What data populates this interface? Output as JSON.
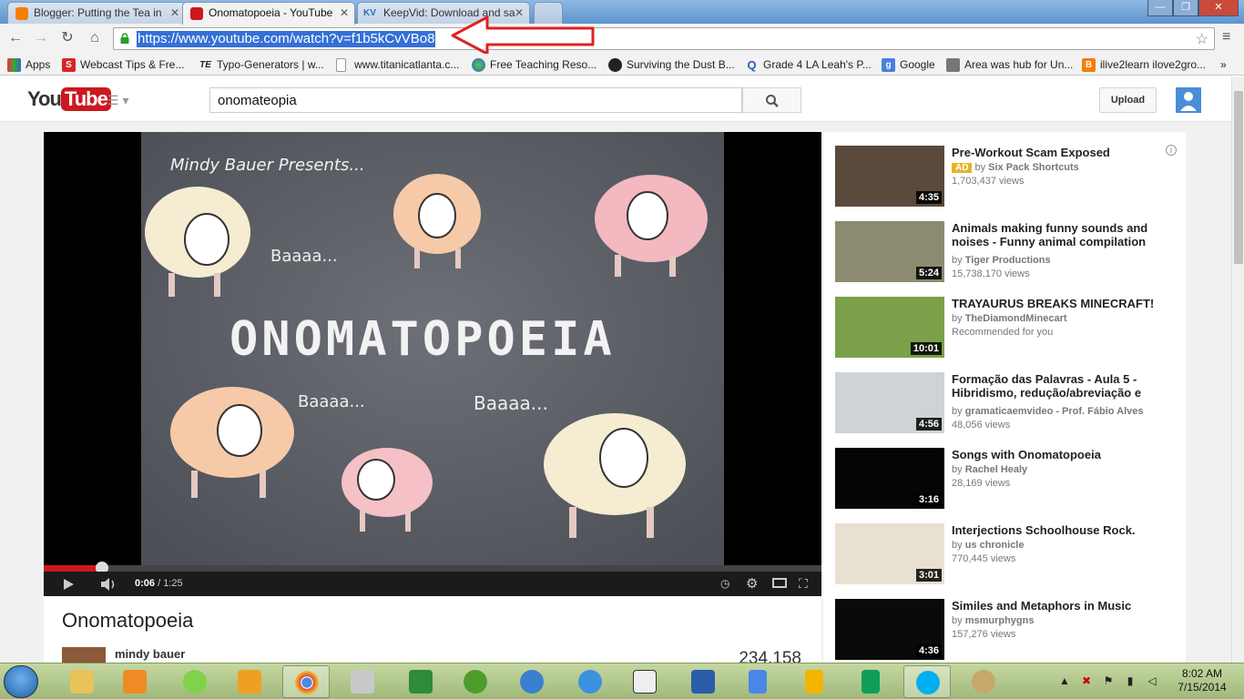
{
  "browser": {
    "tabs": [
      {
        "title": "Blogger: Putting the Tea in",
        "active": false
      },
      {
        "title": "Onomatopoeia - YouTube",
        "active": true
      },
      {
        "title": "KeepVid: Download and sa",
        "active": false
      }
    ],
    "url": "https://www.youtube.com/watch?v=f1b5kCvVBo8",
    "bookmarks": [
      {
        "label": "Apps"
      },
      {
        "label": "Webcast Tips & Fre..."
      },
      {
        "label": "Typo-Generators | w..."
      },
      {
        "label": "www.titanicatlanta.c..."
      },
      {
        "label": "Free Teaching Reso..."
      },
      {
        "label": "Surviving the Dust B..."
      },
      {
        "label": "Grade 4 LA Leah's P..."
      },
      {
        "label": "Google"
      },
      {
        "label": "Area was hub for Un..."
      },
      {
        "label": "ilive2learn ilove2gro..."
      }
    ]
  },
  "youtube": {
    "logo_you": "You",
    "logo_tube": "Tube",
    "search_value": "onomateopia",
    "upload_label": "Upload",
    "player": {
      "current_time": "0:06",
      "duration": " / 1:25",
      "progress_fraction": 0.075,
      "video_text": {
        "presents": "Mindy Bauer Presents...",
        "title": "ONOMATOPOEIA",
        "baa1": "Baaaa...",
        "baa2": "Baaaa...",
        "baa3": "Baaaa..."
      }
    },
    "video_title": "Onomatopoeia",
    "channel_name": "mindy bauer",
    "view_count": "234,158",
    "related": [
      {
        "title": "Pre-Workout Scam Exposed",
        "ad": "AD",
        "by": "by ",
        "channel": "Six Pack Shortcuts",
        "views": "1,703,437 views",
        "duration": "4:35",
        "thumb": "#5a4a3c"
      },
      {
        "title": "Animals making funny sounds and noises - Funny animal compilation",
        "by": "by ",
        "channel": "Tiger Productions",
        "views": "15,738,170 views",
        "duration": "5:24",
        "thumb": "#8c8b72"
      },
      {
        "title": "TRAYAURUS BREAKS MINECRAFT!",
        "by": "by ",
        "channel": "TheDiamondMinecart",
        "views": "Recommended for you",
        "duration": "10:01",
        "thumb": "#7aa04a"
      },
      {
        "title": "Formação das Palavras - Aula 5 - Hibridismo, redução/abreviação e",
        "by": "by ",
        "channel": "gramaticaemvideo - Prof. Fábio Alves",
        "views": "48,056 views",
        "duration": "4:56",
        "thumb": "#cfd3d6"
      },
      {
        "title": "Songs with Onomatopoeia",
        "by": "by ",
        "channel": "Rachel Healy",
        "views": "28,169 views",
        "duration": "3:16",
        "thumb": "#050505"
      },
      {
        "title": "Interjections Schoolhouse Rock.",
        "by": "by ",
        "channel": "us chronicle",
        "views": "770,445 views",
        "duration": "3:01",
        "thumb": "#e8e0d0"
      },
      {
        "title": "Similes and Metaphors in Music",
        "by": "by ",
        "channel": "msmurphygns",
        "views": "157,276 views",
        "duration": "4:36",
        "thumb": "#0a0a0a"
      }
    ]
  },
  "taskbar": {
    "time": "8:02 AM",
    "date": "7/15/2014"
  },
  "colors": {
    "youtube_red": "#cc181e",
    "url_highlight": "#3470d8",
    "annotation_arrow": "#e02020"
  }
}
